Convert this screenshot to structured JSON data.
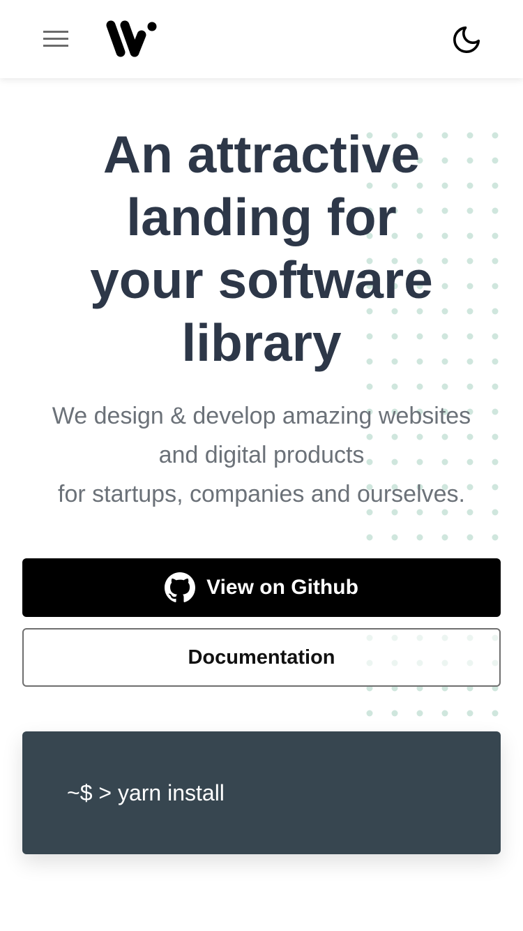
{
  "header": {
    "menu_icon": "hamburger-menu-icon",
    "logo_icon": "brand-w-logo",
    "theme_toggle_icon": "moon-icon"
  },
  "hero": {
    "title_lines": [
      "An attractive",
      "landing for",
      "your software",
      "library"
    ],
    "subtitle_lines": [
      "We design & develop amazing websites",
      "and digital products",
      "for startups, companies and ourselves."
    ]
  },
  "buttons": {
    "github_label": "View on Github",
    "github_icon": "github-icon",
    "docs_label": "Documentation"
  },
  "terminal": {
    "command": "~$ > yarn install"
  },
  "colors": {
    "heading": "#2d3748",
    "subtitle": "#6b7178",
    "dots": "#cfe6dd",
    "terminal_bg": "#374650",
    "primary_button": "#000000"
  }
}
